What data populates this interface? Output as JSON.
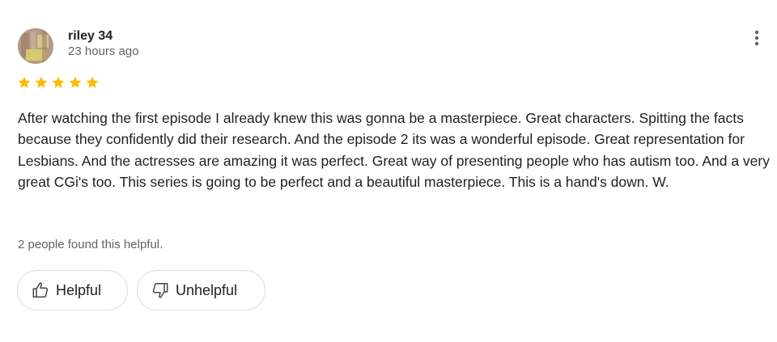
{
  "review": {
    "author": {
      "name": "riley 34",
      "avatar_icon": "user-photo-avatar"
    },
    "timestamp": "23 hours ago",
    "rating": 5,
    "max_rating": 5,
    "star_color": "#fbbc04",
    "text": "After watching the first episode I already knew this was gonna be a masterpiece. Great characters. Spitting the facts because they confidently did their research. And the episode 2 its was a wonderful episode. Great representation for Lesbians. And the actresses are amazing it was perfect. Great way of presenting people who has autism too. And a very great CGi's too. This series is going to be perfect and a beautiful masterpiece. This is a hand's down. W.",
    "helpful_count_text": "2 people found this helpful.",
    "actions": {
      "helpful_label": "Helpful",
      "unhelpful_label": "Unhelpful",
      "helpful_icon": "thumb-up-icon",
      "unhelpful_icon": "thumb-down-icon",
      "more_icon": "more-vert-icon"
    }
  }
}
